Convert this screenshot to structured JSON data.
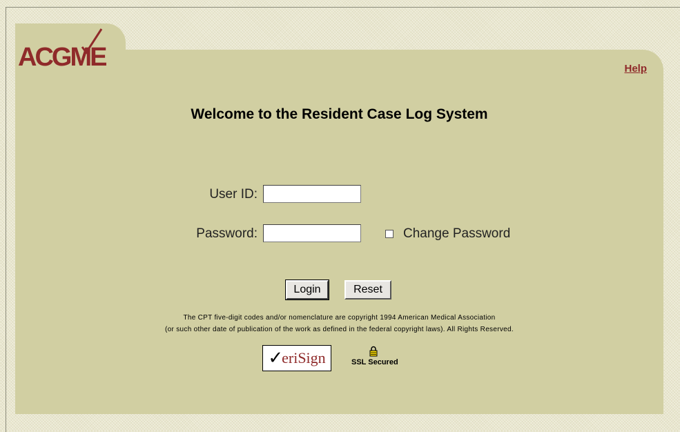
{
  "logo": {
    "text": "ACGME"
  },
  "help_link": "Help",
  "title": "Welcome to the Resident Case Log System",
  "form": {
    "user_id_label": "User ID:",
    "user_id_value": "",
    "password_label": "Password:",
    "password_value": "",
    "change_password_label": "Change Password",
    "change_password_checked": false,
    "login_button": "Login",
    "reset_button": "Reset"
  },
  "copyright": {
    "line1": "The CPT five-digit codes and/or nomenclature are copyright 1994 American Medical Association",
    "line2": "(or such other date of publication of the work as defined in the federal copyright laws). All Rights Reserved."
  },
  "badges": {
    "verisign_text": "eriSign",
    "ssl_text": "SSL Secured"
  },
  "icons": [
    "check-mark-icon",
    "lock-icon"
  ],
  "colors": {
    "panel": "#d1cfa2",
    "background": "#e9e7cf",
    "brand": "#8f2a2a"
  }
}
